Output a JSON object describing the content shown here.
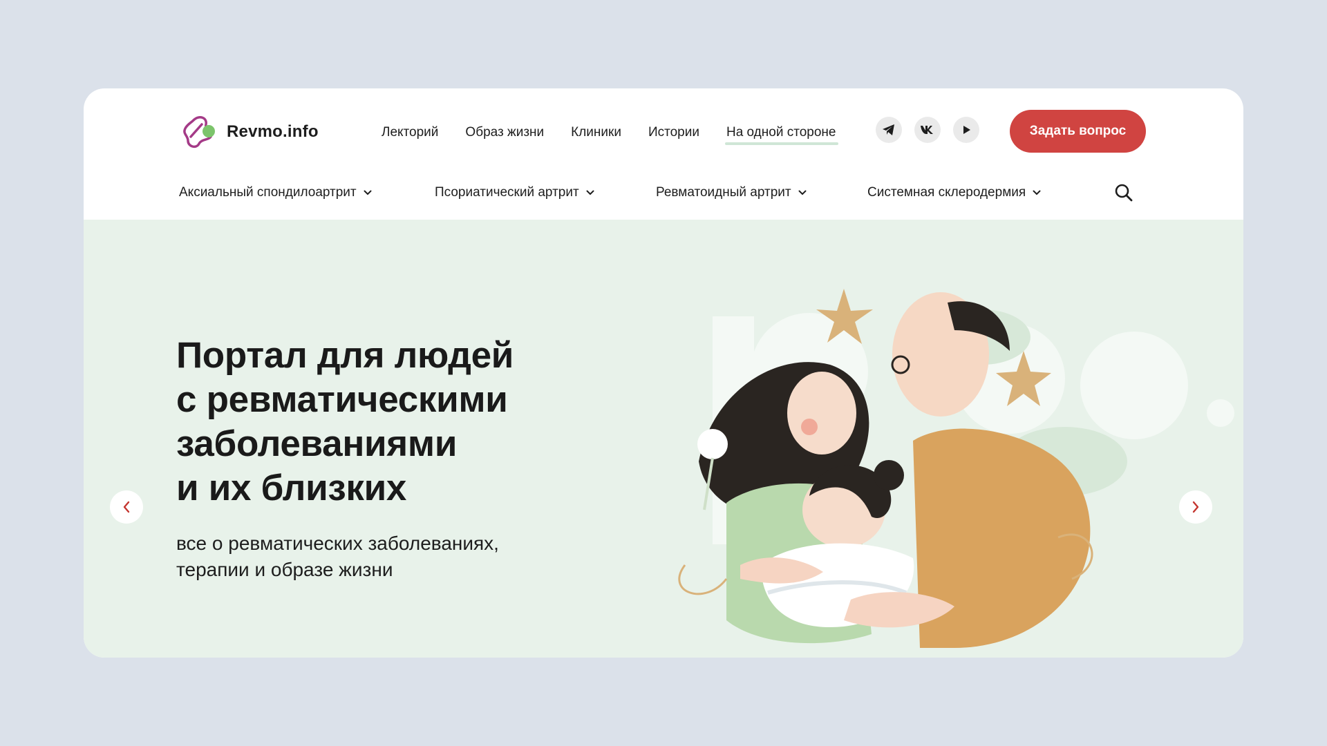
{
  "brand": {
    "name": "Revmo.info"
  },
  "main_nav": [
    {
      "label": "Лекторий"
    },
    {
      "label": "Образ жизни"
    },
    {
      "label": "Клиники"
    },
    {
      "label": "Истории"
    },
    {
      "label": "На одной стороне"
    }
  ],
  "socials": [
    {
      "icon": "telegram-icon"
    },
    {
      "icon": "vk-icon"
    },
    {
      "icon": "youtube-play-icon"
    }
  ],
  "cta": {
    "label": "Задать вопрос",
    "color": "#d04441"
  },
  "sub_nav": [
    {
      "label": "Аксиальный спондилоартрит"
    },
    {
      "label": "Псориатический артрит"
    },
    {
      "label": "Ревматоидный артрит"
    },
    {
      "label": "Системная склеродермия"
    }
  ],
  "hero": {
    "title_lines": [
      "Портал для людей",
      "с ревматическими",
      "заболеваниями",
      "и их близких"
    ],
    "subtitle_lines": [
      "все о ревматических заболеваниях,",
      "терапии и образе жизни"
    ],
    "background": "#e8f2ea"
  },
  "colors": {
    "page_bg": "#dbe1ea",
    "accent_red": "#d04441",
    "hero_green": "#e8f2ea"
  }
}
